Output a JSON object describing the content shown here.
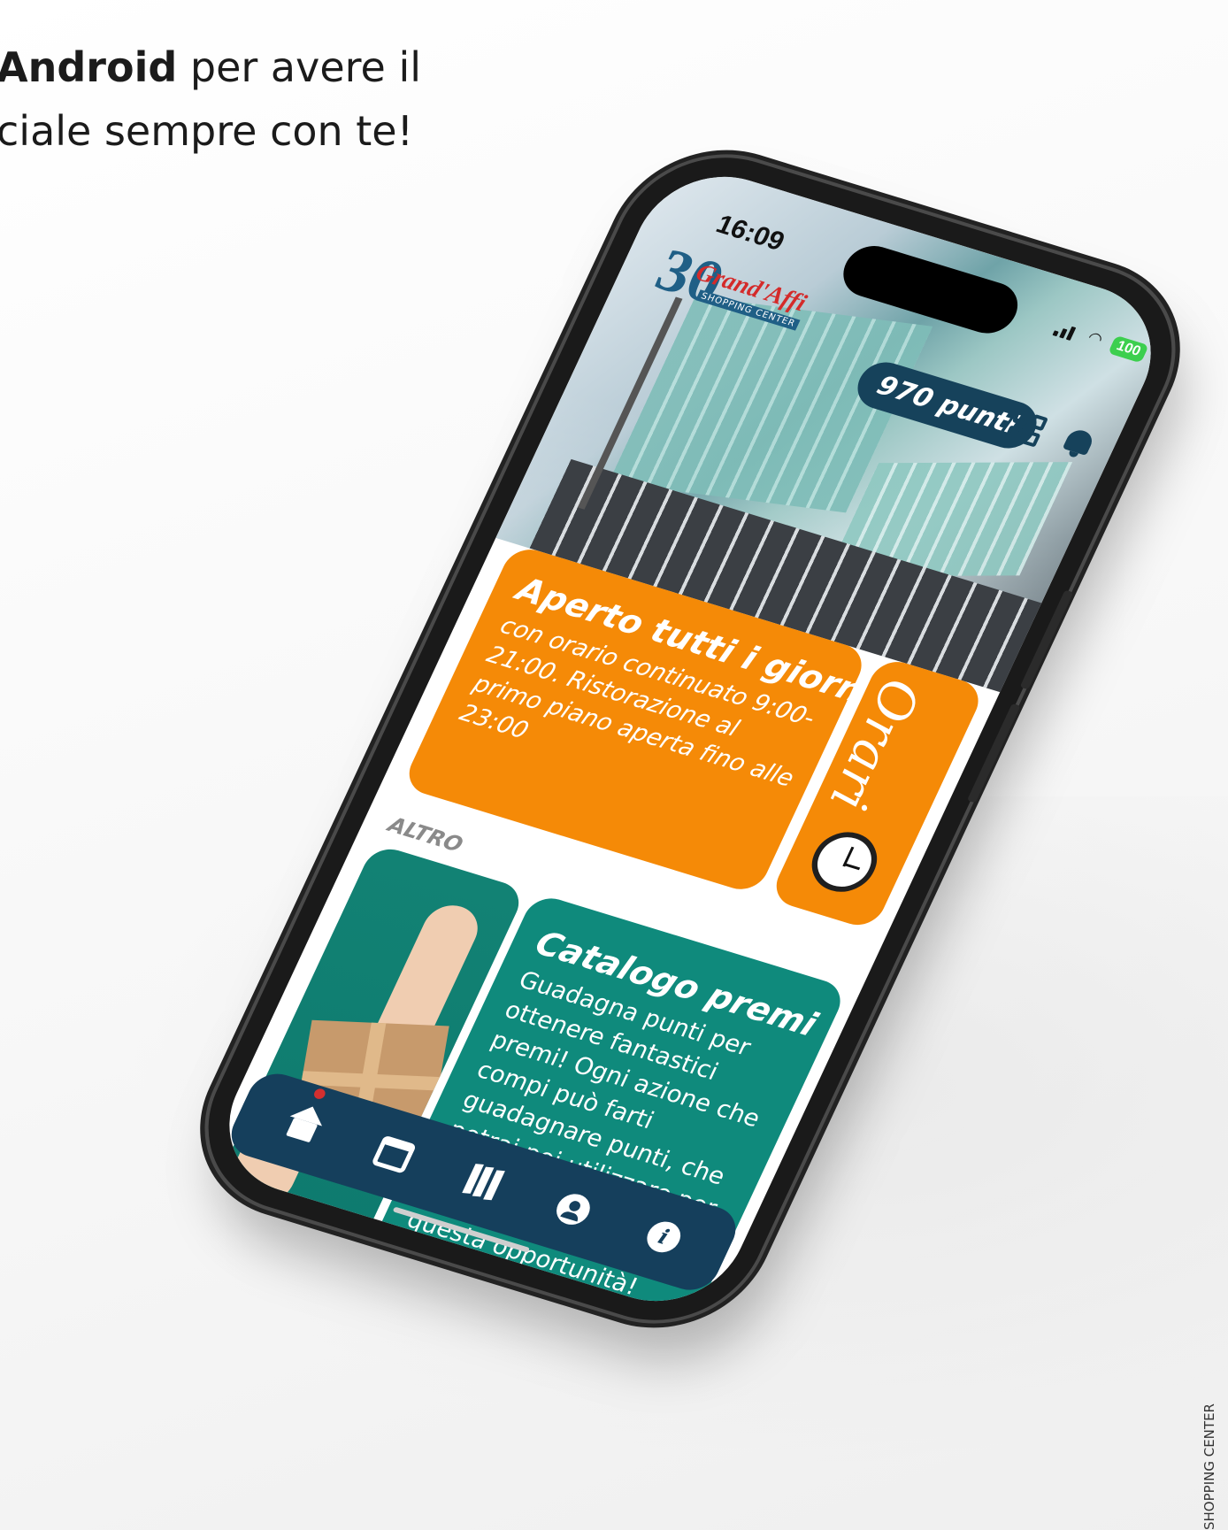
{
  "promo": {
    "line1_bold": "Android",
    "line1_rest": " per avere il",
    "line2": "ciale sempre con te!"
  },
  "side_credit": "SHOPPING CENTER",
  "status_bar": {
    "time": "16:09",
    "battery": "100"
  },
  "app": {
    "logo": {
      "number": "30",
      "name": "Grand'Affi",
      "subtitle": "SHOPPING CENTER"
    },
    "points_badge": "970 punti",
    "icons": [
      "qr-code-icon",
      "bell-icon"
    ],
    "hours_card": {
      "title": "Aperto tutti i giorni",
      "text": "con orario continuato 9:00-21:00. Ristorazione al primo piano aperta fino alle 23:00"
    },
    "orari_card": {
      "label": "Orari"
    },
    "section_label": "ALTRO",
    "catalog_card": {
      "title": "Catalogo premi",
      "text": "Guadagna punti per ottenere fantastici premi! Ogni azione che compi può farti guadagnare punti, che potrai poi utilizzare per ottenere incredibili premi. Non perdere questa opportunità!"
    },
    "navbar": {
      "items": [
        {
          "name": "home",
          "icon": "home-icon",
          "active": true
        },
        {
          "name": "calendar",
          "icon": "calendar-icon"
        },
        {
          "name": "map",
          "icon": "map-icon"
        },
        {
          "name": "profile",
          "icon": "user-icon"
        },
        {
          "name": "info",
          "icon": "info-icon"
        }
      ]
    },
    "colors": {
      "orange": "#f58a07",
      "teal": "#0f8a7c",
      "navy": "#153f5c",
      "red_dot": "#d32f2f",
      "battery_green": "#3ccf4e"
    }
  }
}
